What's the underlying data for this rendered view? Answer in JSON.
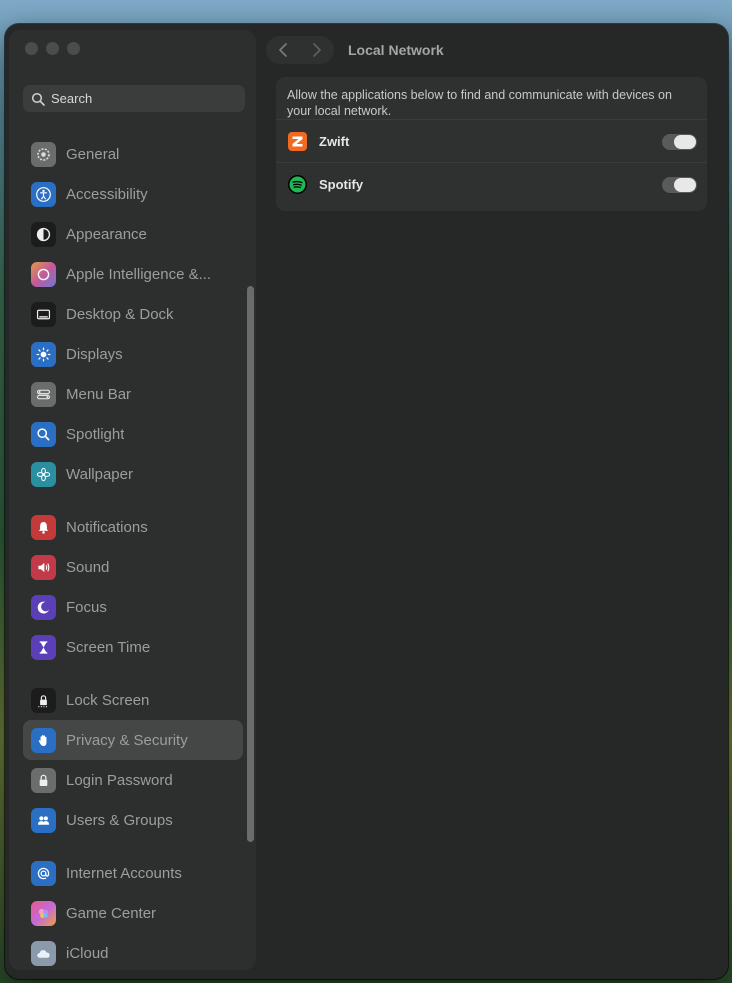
{
  "window": {
    "title": "Local Network"
  },
  "search": {
    "placeholder": "Search"
  },
  "sidebar": {
    "items": [
      {
        "label": "General",
        "icon": "gear-icon",
        "color": "#6b6c6c"
      },
      {
        "label": "Accessibility",
        "icon": "accessibility-icon",
        "color": "#2b6fc4"
      },
      {
        "label": "Appearance",
        "icon": "appearance-icon",
        "color": "#1c1c1c"
      },
      {
        "label": "Apple Intelligence &...",
        "icon": "apple-intelligence-icon",
        "color": "#c26a8a"
      },
      {
        "label": "Desktop & Dock",
        "icon": "dock-icon",
        "color": "#1c1c1c"
      },
      {
        "label": "Displays",
        "icon": "sun-icon",
        "color": "#2b6fc4"
      },
      {
        "label": "Menu Bar",
        "icon": "menu-bar-icon",
        "color": "#6b6c6c"
      },
      {
        "label": "Spotlight",
        "icon": "magnifier-icon",
        "color": "#2b6fc4"
      },
      {
        "label": "Wallpaper",
        "icon": "flower-icon",
        "color": "#2a8fa0"
      },
      {
        "label": "Notifications",
        "icon": "bell-icon",
        "color": "#c23a3a"
      },
      {
        "label": "Sound",
        "icon": "speaker-icon",
        "color": "#c23a4a"
      },
      {
        "label": "Focus",
        "icon": "moon-icon",
        "color": "#5a3fb8"
      },
      {
        "label": "Screen Time",
        "icon": "hourglass-icon",
        "color": "#5a3fb8"
      },
      {
        "label": "Lock Screen",
        "icon": "lock-icon",
        "color": "#1c1c1c"
      },
      {
        "label": "Privacy & Security",
        "icon": "hand-icon",
        "color": "#2b6fc4"
      },
      {
        "label": "Login Password",
        "icon": "padlock-icon",
        "color": "#6b6c6c"
      },
      {
        "label": "Users & Groups",
        "icon": "users-icon",
        "color": "#2b6fc4"
      },
      {
        "label": "Internet Accounts",
        "icon": "at-icon",
        "color": "#2b6fc4"
      },
      {
        "label": "Game Center",
        "icon": "game-center-icon",
        "color": "#c25a8a"
      },
      {
        "label": "iCloud",
        "icon": "cloud-icon",
        "color": "#8a9aaa"
      }
    ],
    "selected": "Privacy & Security"
  },
  "panel": {
    "description": "Allow the applications below to find and communicate with devices on your local network.",
    "apps": [
      {
        "name": "Zwift",
        "icon": "zwift-icon",
        "color": "#f26a21",
        "enabled": true
      },
      {
        "name": "Spotify",
        "icon": "spotify-icon",
        "color": "#1db954",
        "enabled": true
      }
    ]
  }
}
